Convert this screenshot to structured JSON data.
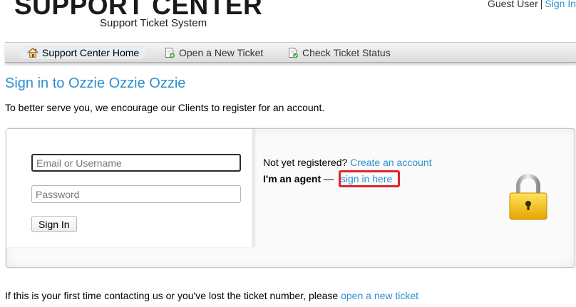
{
  "header": {
    "logo_title": "SUPPORT CENTER",
    "logo_subtitle": "Support Ticket System",
    "user_label": "Guest User",
    "separator": "|",
    "sign_in_link": "Sign In"
  },
  "nav": {
    "items": [
      {
        "label": "Support Center Home",
        "icon": "home-icon",
        "active": true
      },
      {
        "label": "Open a New Ticket",
        "icon": "new-ticket-icon",
        "active": false
      },
      {
        "label": "Check Ticket Status",
        "icon": "ticket-status-icon",
        "active": false
      }
    ]
  },
  "main": {
    "title": "Sign in to Ozzie Ozzie Ozzie",
    "intro": "To better serve you, we encourage our Clients to register for an account."
  },
  "login": {
    "email_placeholder": "Email or Username",
    "email_value": "",
    "password_placeholder": "Password",
    "password_value": "",
    "sign_in_button": "Sign In",
    "not_registered_text": "Not yet registered?",
    "create_account_link": "Create an account",
    "agent_label": "I'm an agent",
    "agent_dash": "—",
    "agent_link": "sign in here",
    "lock_icon": "padlock-icon",
    "highlight_color": "#e0242b"
  },
  "footer": {
    "text": "If this is your first time contacting us or you've lost the ticket number, please",
    "link": "open a new ticket"
  },
  "colors": {
    "link": "#2a8fcf",
    "title": "#2a8fcf"
  }
}
